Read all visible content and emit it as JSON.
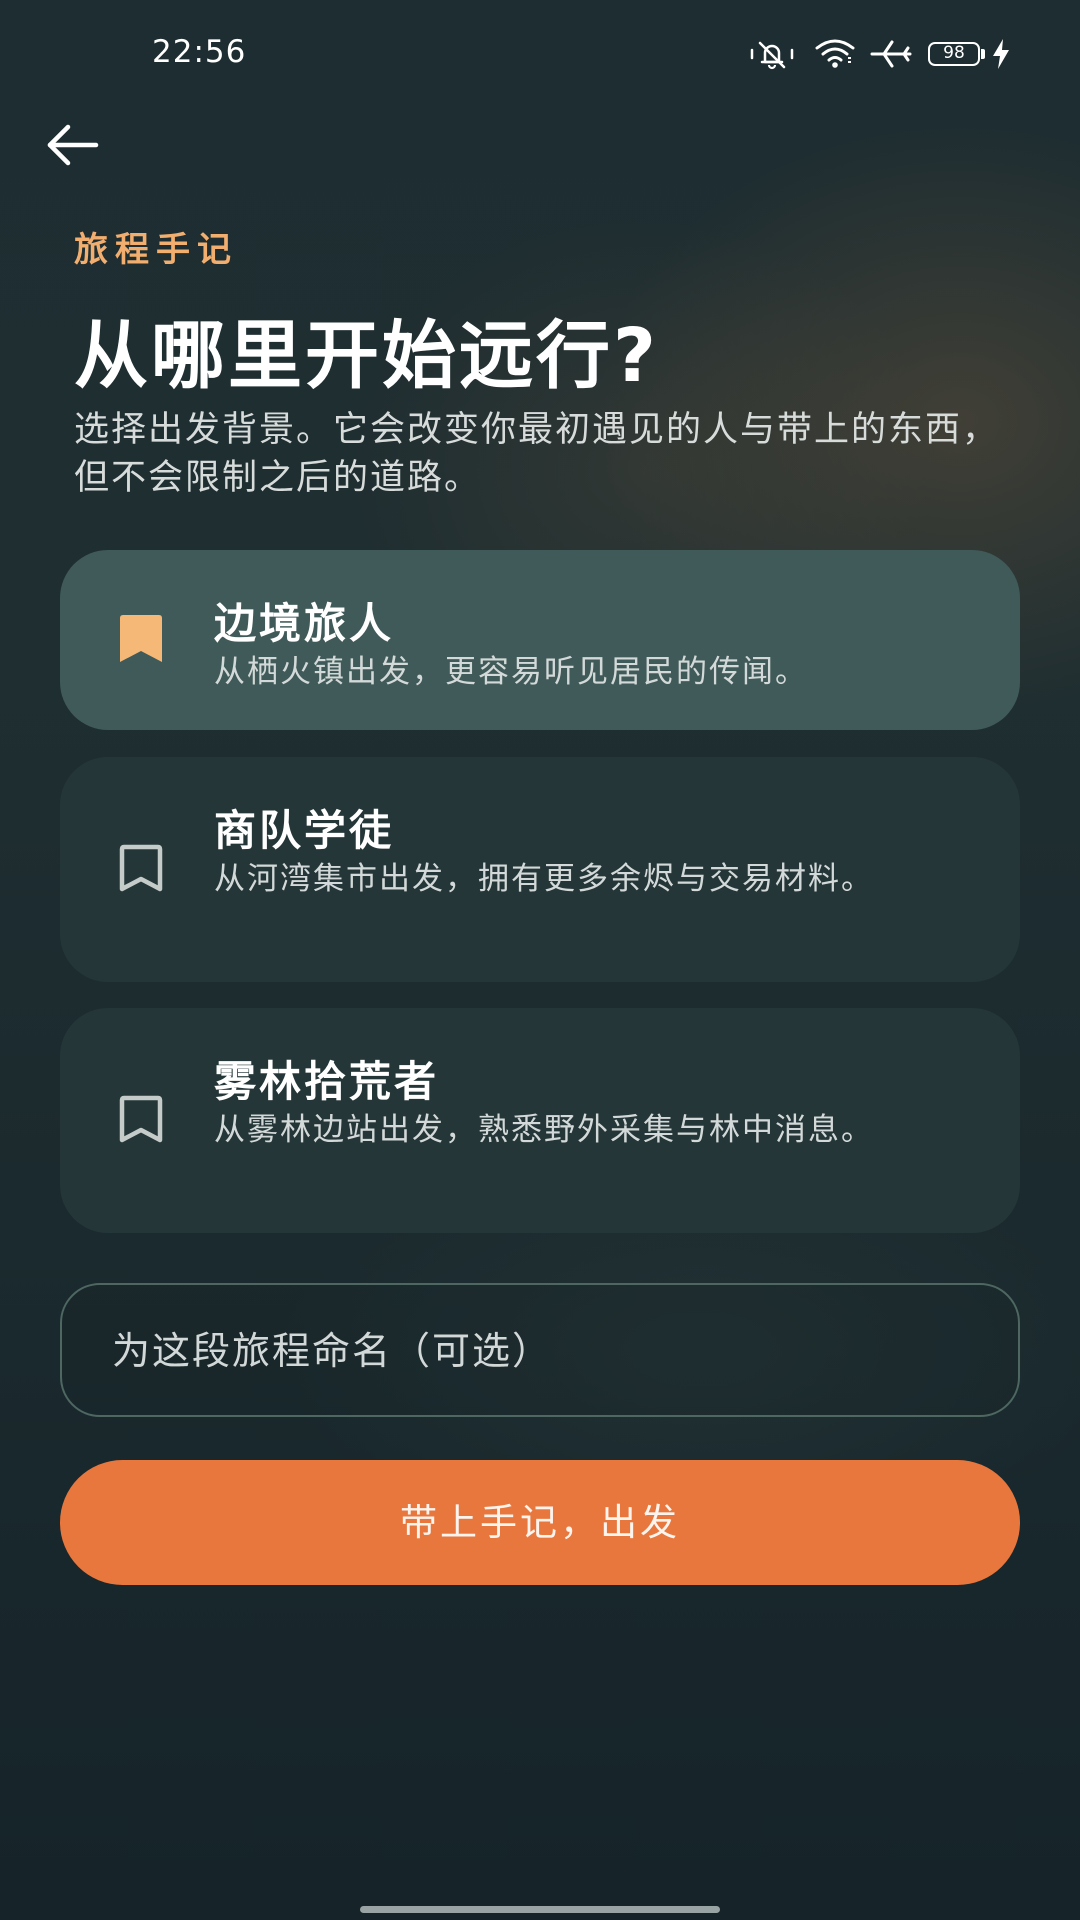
{
  "status_bar": {
    "time": "22:56",
    "battery_level": "98",
    "icons": [
      "bell-muted-icon",
      "wifi-icon",
      "airplane-icon",
      "battery-icon",
      "charging-bolt-icon"
    ]
  },
  "header": {
    "back_icon": "arrow-left-icon",
    "eyebrow": "旅程手记",
    "title": "从哪里开始远行?",
    "description": "选择出发背景。它会改变你最初遇见的人与带上的东西，但不会限制之后的道路。"
  },
  "options": [
    {
      "title": "边境旅人",
      "description": "从栖火镇出发，更容易听见居民的传闻。",
      "selected": true,
      "icon": "bookmark-filled-icon"
    },
    {
      "title": "商队学徒",
      "description": "从河湾集市出发，拥有更多余烬与交易材料。",
      "selected": false,
      "icon": "bookmark-outline-icon"
    },
    {
      "title": "雾林拾荒者",
      "description": "从雾林边站出发，熟悉野外采集与林中消息。",
      "selected": false,
      "icon": "bookmark-outline-icon"
    }
  ],
  "name_field": {
    "placeholder": "为这段旅程命名（可选）",
    "value": ""
  },
  "primary_button": {
    "label": "带上手记，出发"
  },
  "colors": {
    "accent": "#e8773e",
    "eyebrow": "#f2ae6e",
    "bookmark_selected": "#f5b877",
    "card_selected": "#3f5a58",
    "card": "#26383a",
    "background": "#17252a"
  }
}
